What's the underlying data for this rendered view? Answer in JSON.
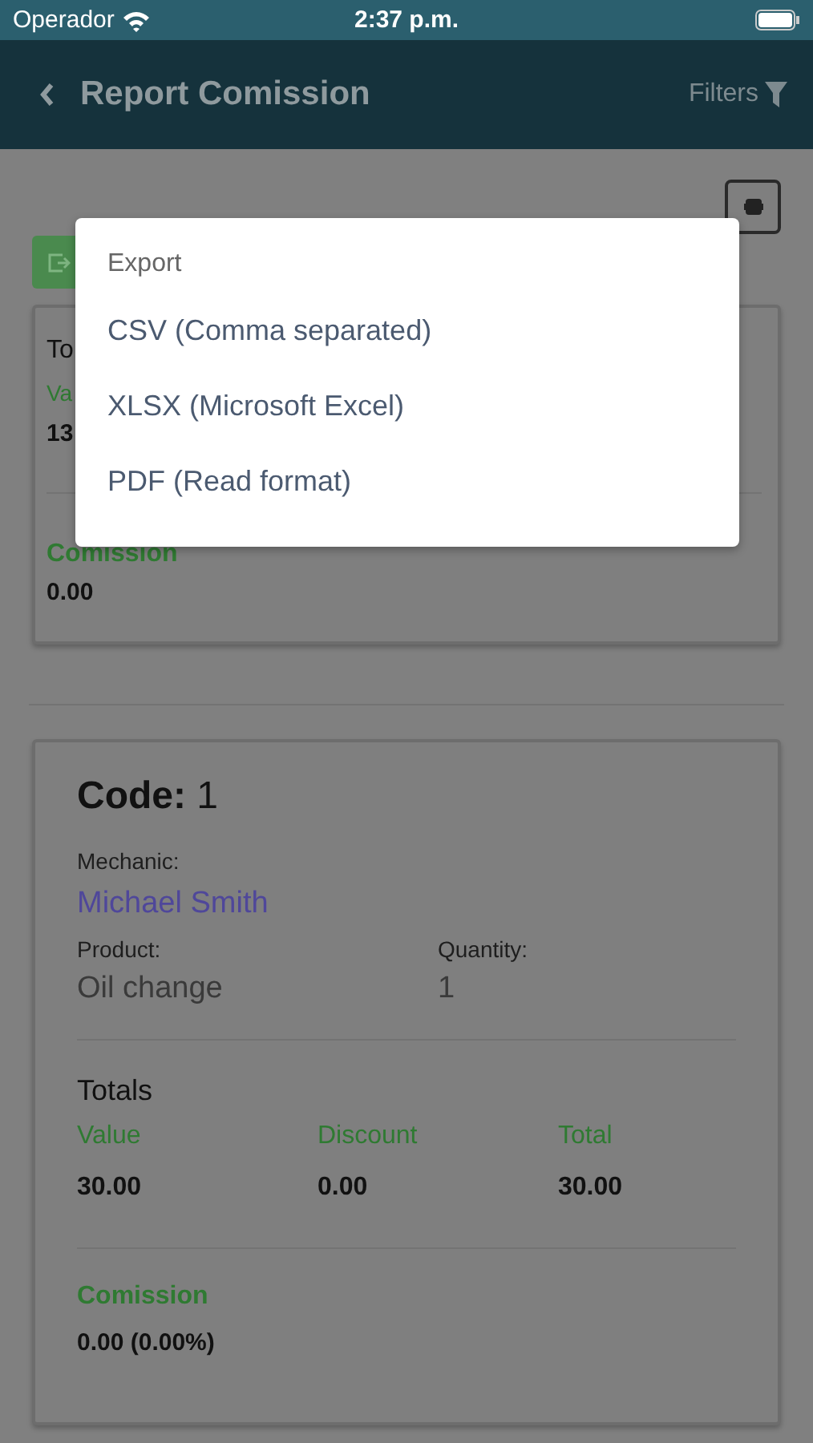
{
  "status_bar": {
    "carrier": "Operador",
    "time": "2:37 p.m."
  },
  "header": {
    "title": "Report Comission",
    "filters_label": "Filters"
  },
  "summary_card": {
    "title": "To",
    "label": "Va",
    "value": "13",
    "commission_label": "Comission",
    "commission_value": "0.00"
  },
  "records": [
    {
      "code_label": "Code:",
      "code": "1",
      "mechanic_label": "Mechanic:",
      "mechanic": "Michael Smith",
      "product_label": "Product:",
      "product": "Oil change",
      "quantity_label": "Quantity:",
      "quantity": "1",
      "totals_title": "Totals",
      "totals": [
        {
          "label": "Value",
          "value": "30.00"
        },
        {
          "label": "Discount",
          "value": "0.00"
        },
        {
          "label": "Total",
          "value": "30.00"
        }
      ],
      "commission_label": "Comission",
      "commission_value": "0.00 (0.00%)"
    }
  ],
  "export_dialog": {
    "title": "Export",
    "options": [
      "CSV (Comma separated)",
      "XLSX (Microsoft Excel)",
      "PDF (Read format)"
    ]
  }
}
